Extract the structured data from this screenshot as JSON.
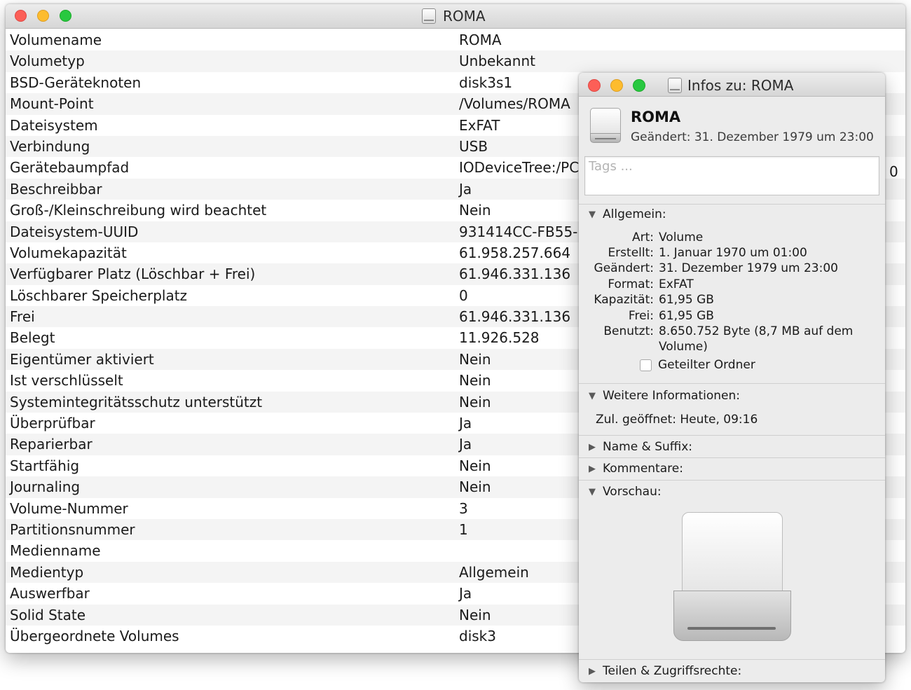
{
  "main_window": {
    "title": "ROMA",
    "rows": [
      {
        "label": "Volumename",
        "value": "ROMA"
      },
      {
        "label": "Volumetyp",
        "value": "Unbekannt"
      },
      {
        "label": "BSD-Geräteknoten",
        "value": "disk3s1"
      },
      {
        "label": "Mount-Point",
        "value": "/Volumes/ROMA"
      },
      {
        "label": "Dateisystem",
        "value": "ExFAT"
      },
      {
        "label": "Verbindung",
        "value": "USB"
      },
      {
        "label": "Gerätebaumpfad",
        "value": "IODeviceTree:/PC"
      },
      {
        "label": "Beschreibbar",
        "value": "Ja"
      },
      {
        "label": "Groß-/Kleinschreibung wird beachtet",
        "value": "Nein"
      },
      {
        "label": "Dateisystem-UUID",
        "value": "931414CC-FB55-"
      },
      {
        "label": "Volumekapazität",
        "value": "61.958.257.664"
      },
      {
        "label": "Verfügbarer Platz (Löschbar + Frei)",
        "value": "61.946.331.136"
      },
      {
        "label": "Löschbarer Speicherplatz",
        "value": "0"
      },
      {
        "label": "Frei",
        "value": "61.946.331.136"
      },
      {
        "label": "Belegt",
        "value": "11.926.528"
      },
      {
        "label": "Eigentümer aktiviert",
        "value": "Nein"
      },
      {
        "label": "Ist verschlüsselt",
        "value": "Nein"
      },
      {
        "label": "Systemintegritätsschutz unterstützt",
        "value": "Nein"
      },
      {
        "label": "Überprüfbar",
        "value": "Ja"
      },
      {
        "label": "Reparierbar",
        "value": "Ja"
      },
      {
        "label": "Startfähig",
        "value": "Nein"
      },
      {
        "label": "Journaling",
        "value": "Nein"
      },
      {
        "label": "Volume-Nummer",
        "value": "3"
      },
      {
        "label": "Partitionsnummer",
        "value": "1"
      },
      {
        "label": "Medienname",
        "value": ""
      },
      {
        "label": "Medientyp",
        "value": "Allgemein"
      },
      {
        "label": "Auswerfbar",
        "value": "Ja"
      },
      {
        "label": "Solid State",
        "value": "Nein"
      },
      {
        "label": "Übergeordnete Volumes",
        "value": "disk3"
      }
    ],
    "edge_char": "0"
  },
  "info_panel": {
    "title": "Infos zu: ROMA",
    "name": "ROMA",
    "modified": "Geändert: 31. Dezember 1979 um 23:00",
    "tags_placeholder": "Tags ...",
    "sections": {
      "allgemein": "Allgemein:",
      "weitere": "Weitere Informationen:",
      "name_suffix": "Name & Suffix:",
      "kommentare": "Kommentare:",
      "vorschau": "Vorschau:",
      "teilen": "Teilen & Zugriffsrechte:"
    },
    "general": [
      {
        "key": "Art:",
        "value": "Volume"
      },
      {
        "key": "Erstellt:",
        "value": "1. Januar 1970 um 01:00"
      },
      {
        "key": "Geändert:",
        "value": "31. Dezember 1979 um 23:00"
      },
      {
        "key": "Format:",
        "value": "ExFAT"
      },
      {
        "key": "Kapazität:",
        "value": "61,95 GB"
      },
      {
        "key": "Frei:",
        "value": "61,95 GB"
      },
      {
        "key": "Benutzt:",
        "value": "8.650.752 Byte (8,7 MB auf dem Volume)"
      }
    ],
    "shared_folder_label": "Geteilter Ordner",
    "shared_folder_checked": false,
    "last_opened": "Zul. geöffnet: Heute, 09:16",
    "icons": {
      "disclosure_open": "▼",
      "disclosure_closed": "▶"
    }
  }
}
